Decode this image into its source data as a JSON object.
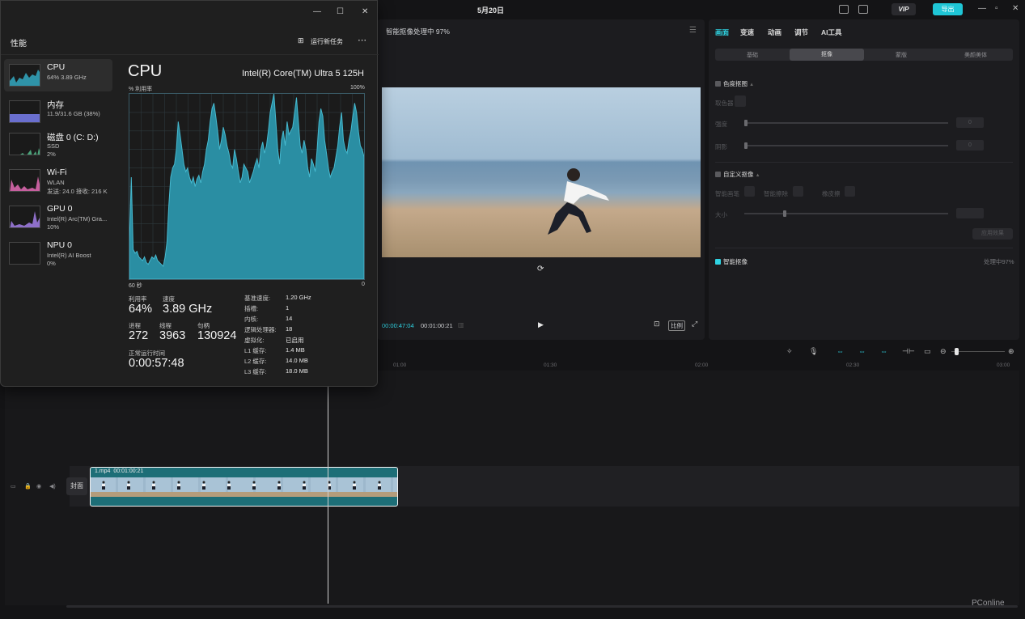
{
  "editor": {
    "date": "5月20日",
    "vip": "VIP",
    "export": "导出",
    "player": {
      "title": "智能抠像处理中 97%",
      "time_current": "00:00:47:04",
      "time_total": "00:01:00:21",
      "ratio_label": "比例"
    },
    "props": {
      "tabs": [
        "画面",
        "变速",
        "动画",
        "调节",
        "AI工具"
      ],
      "subtabs": [
        "基础",
        "抠像",
        "蒙版",
        "美颜美体"
      ],
      "chroma_key": "色度抠图",
      "color_picker": "取色器",
      "intensity": "强度",
      "shadow": "阴影",
      "custom_key": "自定义抠像",
      "smart_brush": "智能画笔",
      "smart_eraser": "智能擦除",
      "erase": "橡皮擦",
      "size": "大小",
      "apply": "应用效果",
      "smart_key": "智能抠像",
      "processing": "处理中97%",
      "zero": "0"
    },
    "timeline": {
      "ticks": [
        "01:00",
        "01:30",
        "02:00",
        "02:30",
        "03:00"
      ],
      "clip_name": "1.mp4",
      "clip_duration": "00:01:00:21",
      "cover": "封面"
    },
    "watermark": "PConline"
  },
  "taskmgr": {
    "title": "性能",
    "run_task": "运行新任务",
    "devices": [
      {
        "name": "CPU",
        "s1": "64% 3.89 GHz",
        "s2": ""
      },
      {
        "name": "内存",
        "s1": "11.9/31.6 GB (38%)",
        "s2": ""
      },
      {
        "name": "磁盘 0 (C: D:)",
        "s1": "SSD",
        "s2": "2%"
      },
      {
        "name": "Wi-Fi",
        "s1": "WLAN",
        "s2": "发送: 24.0  接收: 216 K"
      },
      {
        "name": "GPU 0",
        "s1": "Intel(R) Arc(TM) Gra...",
        "s2": "10%"
      },
      {
        "name": "NPU 0",
        "s1": "Intel(R) AI Boost",
        "s2": "0%"
      }
    ],
    "cpu_title": "CPU",
    "cpu_model": "Intel(R) Core(TM) Ultra 5 125H",
    "axis": {
      "top_left": "% 利用率",
      "top_right": "100%",
      "bottom_left": "60 秒",
      "bottom_right": "0"
    },
    "stats": {
      "util_label": "利用率",
      "util": "64%",
      "speed_label": "速度",
      "speed": "3.89 GHz",
      "proc_label": "进程",
      "proc": "272",
      "thread_label": "线程",
      "thread": "3963",
      "handle_label": "句柄",
      "handle": "130924",
      "uptime_label": "正常运行时间",
      "uptime": "0:00:57:48"
    },
    "specs": [
      {
        "k": "基准速度:",
        "v": "1.20 GHz"
      },
      {
        "k": "插槽:",
        "v": "1"
      },
      {
        "k": "内核:",
        "v": "14"
      },
      {
        "k": "逻辑处理器:",
        "v": "18"
      },
      {
        "k": "虚拟化:",
        "v": "已启用"
      },
      {
        "k": "L1 缓存:",
        "v": "1.4 MB"
      },
      {
        "k": "L2 缓存:",
        "v": "14.0 MB"
      },
      {
        "k": "L3 缓存:",
        "v": "18.0 MB"
      }
    ],
    "cpu_history": [
      20,
      55,
      16,
      14,
      15,
      12,
      11,
      10,
      12,
      9,
      8,
      10,
      12,
      11,
      13,
      10,
      9,
      8,
      7,
      12,
      20,
      40,
      55,
      60,
      62,
      70,
      85,
      78,
      70,
      62,
      58,
      60,
      55,
      52,
      55,
      50,
      54,
      56,
      52,
      58,
      62,
      70,
      75,
      85,
      92,
      95,
      88,
      80,
      70,
      75,
      82,
      78,
      72,
      68,
      62,
      60,
      70,
      65,
      58,
      52,
      55,
      62,
      60,
      58,
      52,
      55,
      58,
      62,
      65,
      60,
      70,
      74,
      68,
      72,
      80,
      90,
      95,
      100,
      85,
      70,
      62,
      75,
      80,
      72,
      85,
      78,
      80,
      82,
      90,
      98,
      85,
      72,
      68,
      75,
      70,
      60,
      55,
      65,
      62,
      58,
      70,
      85,
      92,
      88,
      75,
      68,
      60,
      55,
      58,
      60,
      66,
      72,
      82,
      90,
      75,
      70,
      68,
      75,
      80,
      88,
      95,
      90,
      80,
      72,
      70,
      66
    ]
  }
}
